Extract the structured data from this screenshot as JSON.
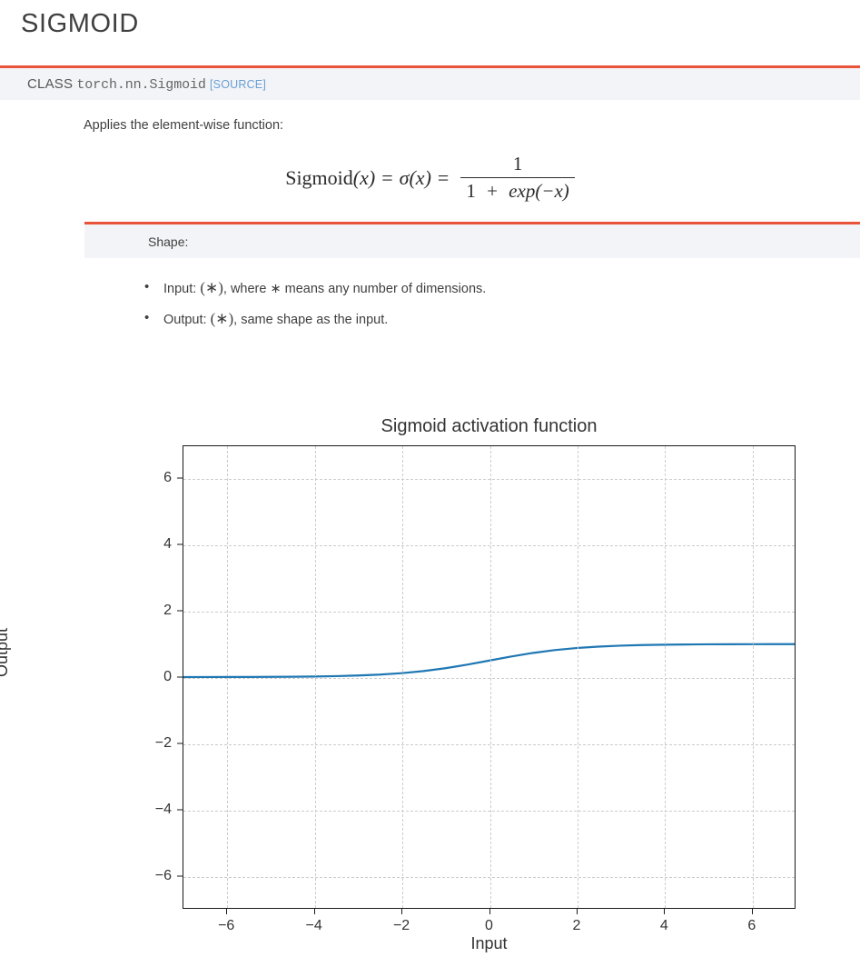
{
  "page": {
    "title": "SIGMOID"
  },
  "class_signature": {
    "keyword": "CLASS",
    "path": "torch.nn.Sigmoid",
    "source_link": "[SOURCE]",
    "accent_color": "#e8533a",
    "background_color": "#f3f4f7",
    "link_color": "#6a9fd4"
  },
  "description": {
    "text": "Applies the element-wise function:"
  },
  "formula": {
    "lhs_name": "Sigmoid",
    "lhs_arg": "(x)",
    "equals": "=",
    "sigma": "σ",
    "sigma_arg": "(x)",
    "equals2": "=",
    "numerator": "1",
    "denominator_one": "1",
    "denominator_plus": "+",
    "denominator_exp": "exp(−x)",
    "plain": "Sigmoid(x) = σ(x) = 1 / (1 + exp(−x))"
  },
  "shape": {
    "label": "Shape:",
    "accent_color": "#e8533a",
    "background_color": "#f3f4f7",
    "items": [
      {
        "prefix": "Input: ",
        "symbol": "(∗)",
        "suffix": ", where ∗ means any number of dimensions."
      },
      {
        "prefix": "Output: ",
        "symbol": "(∗)",
        "suffix": ", same shape as the input."
      }
    ]
  },
  "chart_data": {
    "type": "line",
    "title": "Sigmoid activation function",
    "xlabel": "Input",
    "ylabel": "Output",
    "xlim": [
      -7,
      7
    ],
    "ylim": [
      -7,
      7
    ],
    "grid": true,
    "legend": null,
    "line_color": "#1f77b4",
    "line_width": 2,
    "xticks": [
      -6,
      -4,
      -2,
      0,
      2,
      4,
      6
    ],
    "xtick_labels": [
      "−6",
      "−4",
      "−2",
      "0",
      "2",
      "4",
      "6"
    ],
    "yticks": [
      6,
      4,
      2,
      0,
      -2,
      -4,
      -6
    ],
    "ytick_labels": [
      "6",
      "4",
      "2",
      "0",
      "−2",
      "−4",
      "−6"
    ],
    "series": [
      {
        "name": "sigmoid",
        "x": [
          -7,
          -6.5,
          -6,
          -5.5,
          -5,
          -4.5,
          -4,
          -3.5,
          -3,
          -2.5,
          -2,
          -1.5,
          -1,
          -0.5,
          0,
          0.5,
          1,
          1.5,
          2,
          2.5,
          3,
          3.5,
          4,
          4.5,
          5,
          5.5,
          6,
          6.5,
          7
        ],
        "y": [
          0.0009,
          0.0015,
          0.0025,
          0.0041,
          0.0067,
          0.011,
          0.018,
          0.0293,
          0.0474,
          0.0759,
          0.1192,
          0.1824,
          0.2689,
          0.3775,
          0.5,
          0.6225,
          0.7311,
          0.8176,
          0.8808,
          0.9241,
          0.9526,
          0.9707,
          0.982,
          0.989,
          0.9933,
          0.9959,
          0.9975,
          0.9985,
          0.9991
        ]
      }
    ]
  }
}
